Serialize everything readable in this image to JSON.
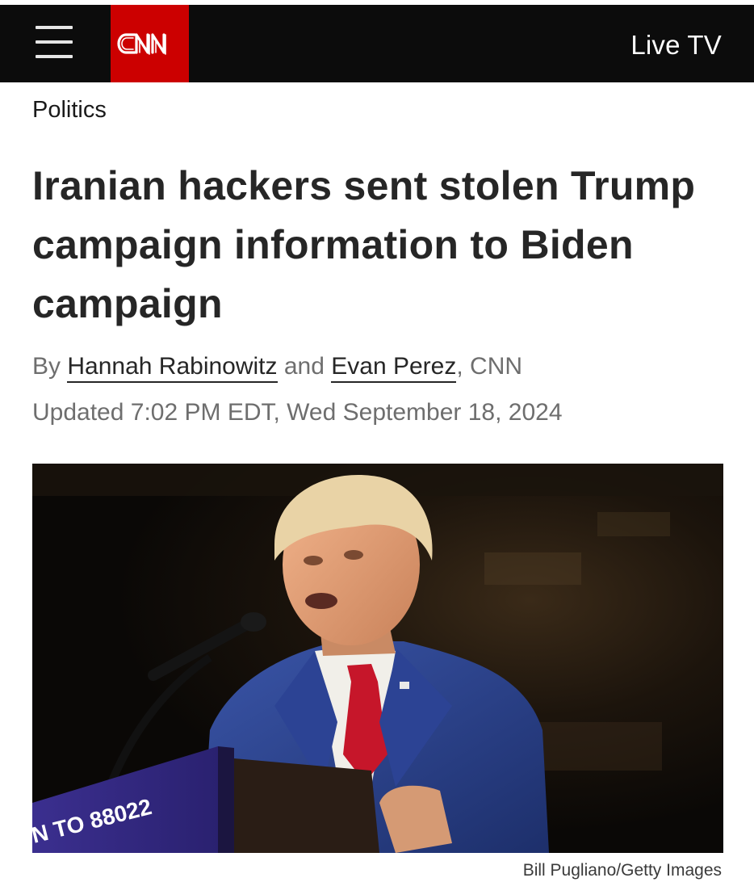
{
  "header": {
    "menu_icon": "hamburger-menu-icon",
    "logo_text": "CNN",
    "brand_color": "#cc0000",
    "live_tv_label": "Live TV"
  },
  "article": {
    "section": "Politics",
    "headline": "Iranian hackers sent stolen Trump campaign information to Biden campaign",
    "byline": {
      "prefix": "By",
      "author1": "Hannah Rabinowitz",
      "conjunction": "and",
      "author2": "Evan Perez",
      "outlet": ", CNN"
    },
    "timestamp": "Updated 7:02 PM EDT, Wed September 18, 2024"
  },
  "image": {
    "description_icon": "photo-trump-at-podium",
    "podium_text": "N TO 88022",
    "credit": "Bill Pugliano/Getty Images"
  }
}
